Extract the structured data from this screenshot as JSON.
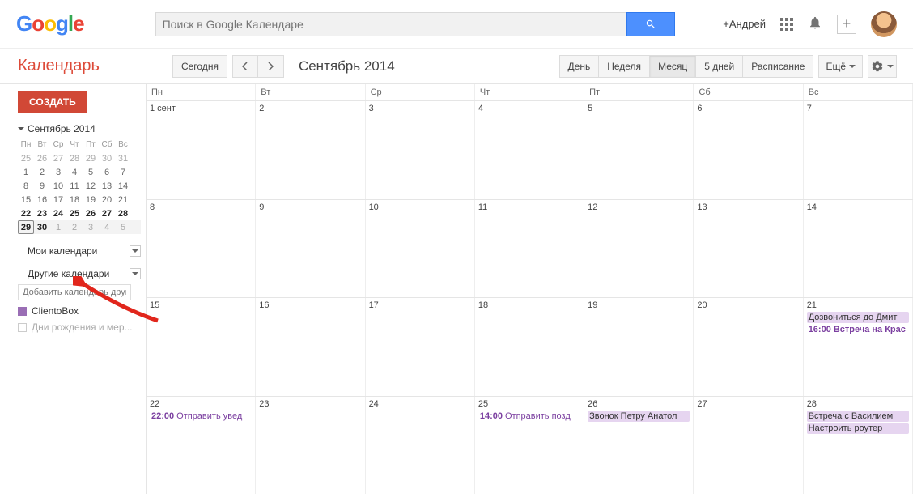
{
  "topbar": {
    "search_placeholder": "Поиск в Google Календаре",
    "user_link": "+Андрей"
  },
  "subbar": {
    "brand": "Календарь",
    "today": "Сегодня",
    "month_label": "Сентябрь 2014",
    "views": {
      "day": "День",
      "week": "Неделя",
      "month": "Месяц",
      "five": "5 дней",
      "agenda": "Расписание"
    },
    "more": "Ещё"
  },
  "sidebar": {
    "create": "СОЗДАТЬ",
    "mini_month": "Сентябрь 2014",
    "dow": [
      "Пн",
      "Вт",
      "Ср",
      "Чт",
      "Пт",
      "Сб",
      "Вс"
    ],
    "mini_weeks": [
      [
        "25",
        "26",
        "27",
        "28",
        "29",
        "30",
        "31"
      ],
      [
        "1",
        "2",
        "3",
        "4",
        "5",
        "6",
        "7"
      ],
      [
        "8",
        "9",
        "10",
        "11",
        "12",
        "13",
        "14"
      ],
      [
        "15",
        "16",
        "17",
        "18",
        "19",
        "20",
        "21"
      ],
      [
        "22",
        "23",
        "24",
        "25",
        "26",
        "27",
        "28"
      ],
      [
        "29",
        "30",
        "1",
        "2",
        "3",
        "4",
        "5"
      ]
    ],
    "my_cal": "Мои календари",
    "other_cal": "Другие календари",
    "add_placeholder": "Добавить календарь друга",
    "cal_clientobox": "ClientoBox",
    "cal_bdays": "Дни рождения и мер..."
  },
  "grid": {
    "dow": [
      "Пн",
      "Вт",
      "Ср",
      "Чт",
      "Пт",
      "Сб",
      "Вс"
    ],
    "weeks": [
      [
        {
          "n": "1 сент"
        },
        {
          "n": "2"
        },
        {
          "n": "3"
        },
        {
          "n": "4"
        },
        {
          "n": "5"
        },
        {
          "n": "6"
        },
        {
          "n": "7"
        }
      ],
      [
        {
          "n": "8"
        },
        {
          "n": "9"
        },
        {
          "n": "10"
        },
        {
          "n": "11"
        },
        {
          "n": "12"
        },
        {
          "n": "13"
        },
        {
          "n": "14"
        }
      ],
      [
        {
          "n": "15"
        },
        {
          "n": "16"
        },
        {
          "n": "17"
        },
        {
          "n": "18"
        },
        {
          "n": "19"
        },
        {
          "n": "20"
        },
        {
          "n": "21",
          "ev": [
            {
              "cls": "purple-bg",
              "text": "Дозвониться до Дмит"
            },
            {
              "cls": "purple-bold",
              "time": "16:00",
              "text": "Встреча на Крас"
            }
          ]
        }
      ],
      [
        {
          "n": "22",
          "ev": [
            {
              "cls": "purple-text",
              "time": "22:00",
              "text": "Отправить увед"
            }
          ]
        },
        {
          "n": "23"
        },
        {
          "n": "24"
        },
        {
          "n": "25",
          "ev": [
            {
              "cls": "purple-text",
              "time": "14:00",
              "text": "Отправить позд"
            }
          ]
        },
        {
          "n": "26",
          "ev": [
            {
              "cls": "purple-bg",
              "text": "Звонок Петру Анатол"
            }
          ]
        },
        {
          "n": "27"
        },
        {
          "n": "28",
          "ev": [
            {
              "cls": "purple-bg",
              "text": "Встреча с Василием"
            },
            {
              "cls": "purple-bg",
              "text": "Настроить роутер"
            }
          ]
        }
      ]
    ]
  }
}
